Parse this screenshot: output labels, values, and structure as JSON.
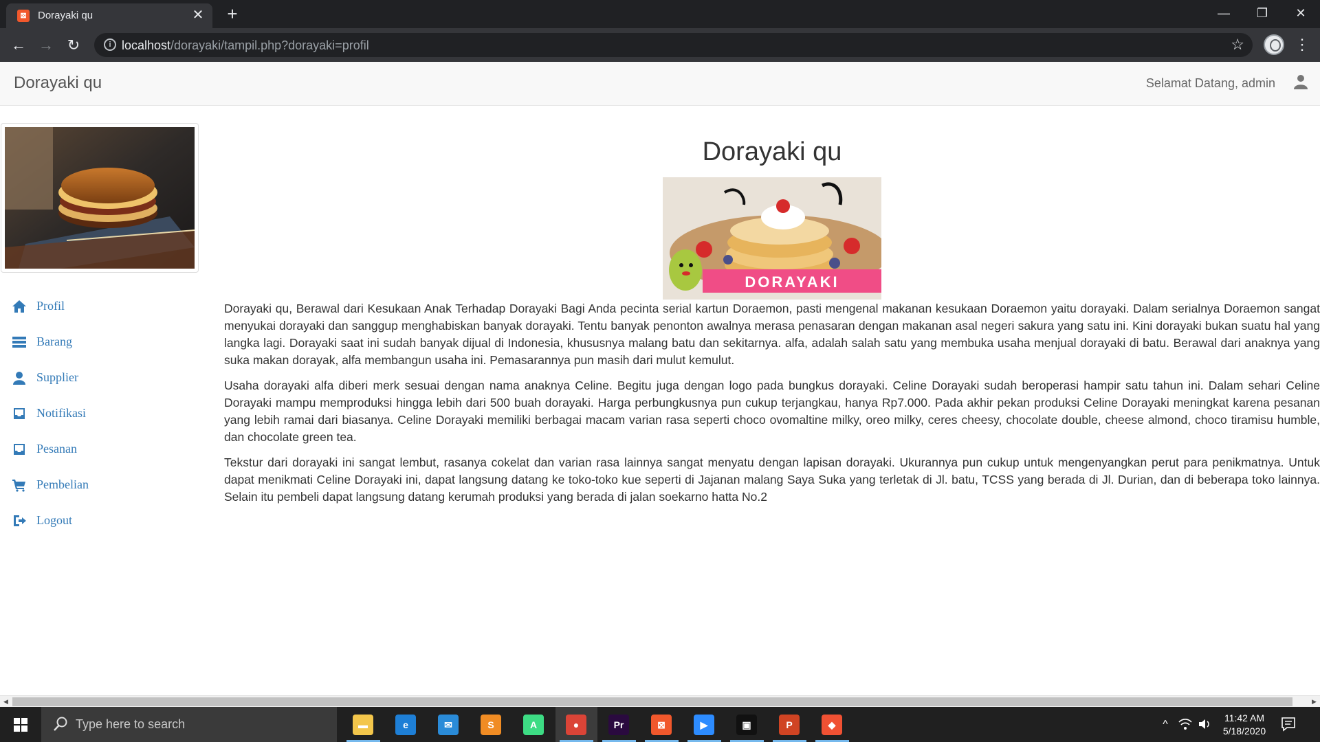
{
  "browser": {
    "tab_title": "Dorayaki qu",
    "favicon_glyph": "⊠",
    "close_glyph": "✕",
    "newtab_glyph": "+",
    "url_host": "localhost",
    "url_path": "/dorayaki/tampil.php?dorayaki=profil",
    "window_controls": [
      "—",
      "❐",
      "✕"
    ],
    "menu_glyph": "⋮",
    "star_glyph": "☆"
  },
  "navbar": {
    "brand": "Dorayaki qu",
    "welcome": "Selamat Datang, admin"
  },
  "sidebar": {
    "items": [
      {
        "label": "Profil",
        "icon": "home-icon"
      },
      {
        "label": "Barang",
        "icon": "list-icon"
      },
      {
        "label": "Supplier",
        "icon": "user-icon"
      },
      {
        "label": "Notifikasi",
        "icon": "inbox-icon"
      },
      {
        "label": "Pesanan",
        "icon": "inbox-icon"
      },
      {
        "label": "Pembelian",
        "icon": "cart-icon"
      },
      {
        "label": "Logout",
        "icon": "logout-icon"
      }
    ]
  },
  "main": {
    "title": "Dorayaki qu",
    "hero_text": "DORAYAKI",
    "paragraphs": [
      "Dorayaki qu, Berawal dari Kesukaan Anak Terhadap Dorayaki Bagi Anda pecinta serial kartun Doraemon, pasti mengenal makanan kesukaan Doraemon yaitu dorayaki. Dalam serialnya Doraemon sangat menyukai dorayaki dan sanggup menghabiskan banyak dorayaki. Tentu banyak penonton awalnya merasa penasaran dengan makanan asal negeri sakura yang satu ini. Kini dorayaki bukan suatu hal yang langka lagi. Dorayaki saat ini sudah banyak dijual di Indonesia, khususnya malang batu dan sekitarnya. alfa, adalah salah satu yang membuka usaha menjual dorayaki di batu. Berawal dari anaknya yang suka makan dorayak, alfa membangun usaha ini. Pemasarannya pun masih dari mulut kemulut.",
      "Usaha dorayaki alfa diberi merk sesuai dengan nama anaknya Celine. Begitu juga dengan logo pada bungkus dorayaki. Celine Dorayaki sudah beroperasi hampir satu tahun ini. Dalam sehari Celine Dorayaki mampu memproduksi hingga lebih dari 500 buah dorayaki. Harga perbungkusnya pun cukup terjangkau, hanya Rp7.000. Pada akhir pekan produksi Celine Dorayaki meningkat karena pesanan yang lebih ramai dari biasanya. Celine Dorayaki memiliki berbagai macam varian rasa seperti choco ovomaltine milky, oreo milky, ceres cheesy, chocolate double, cheese almond, choco tiramisu humble, dan chocolate green tea.",
      "Tekstur dari dorayaki ini sangat lembut, rasanya cokelat dan varian rasa lainnya sangat menyatu dengan lapisan dorayaki. Ukurannya pun cukup untuk mengenyangkan perut para penikmatnya. Untuk dapat menikmati Celine Dorayaki ini, dapat langsung datang ke toko-toko kue seperti di Jajanan malang Saya Suka yang terletak di Jl. batu, TCSS yang berada di Jl. Durian, dan di beberapa toko lainnya. Selain itu pembeli dapat langsung datang kerumah produksi yang berada di jalan soekarno hatta No.2"
    ]
  },
  "taskbar": {
    "search_placeholder": "Type here to search",
    "apps": [
      {
        "name": "file-explorer",
        "glyph": "▬",
        "color": "#f3c64b"
      },
      {
        "name": "edge",
        "glyph": "e",
        "color": "#1e7fd6"
      },
      {
        "name": "mail",
        "glyph": "✉",
        "color": "#2a8bd8"
      },
      {
        "name": "sublime-text",
        "glyph": "S",
        "color": "#f08c24"
      },
      {
        "name": "android-studio",
        "glyph": "A",
        "color": "#3ddc84"
      },
      {
        "name": "chrome",
        "glyph": "●",
        "color": "#db4437"
      },
      {
        "name": "premiere-pro",
        "glyph": "Pr",
        "color": "#2a0a3f"
      },
      {
        "name": "xampp",
        "glyph": "⊠",
        "color": "#f1582c"
      },
      {
        "name": "zoom",
        "glyph": "▶",
        "color": "#2d8cff"
      },
      {
        "name": "terminal-app",
        "glyph": "▣",
        "color": "#111111"
      },
      {
        "name": "powerpoint",
        "glyph": "P",
        "color": "#d04423"
      },
      {
        "name": "git",
        "glyph": "◆",
        "color": "#f05133"
      }
    ],
    "tray_chevron": "^",
    "time": "11:42 AM",
    "date": "5/18/2020"
  },
  "colors": {
    "accent_link": "#337ab7",
    "chrome_dark": "#202124",
    "chrome_toolbar": "#35363a",
    "taskbar": "#202020"
  }
}
